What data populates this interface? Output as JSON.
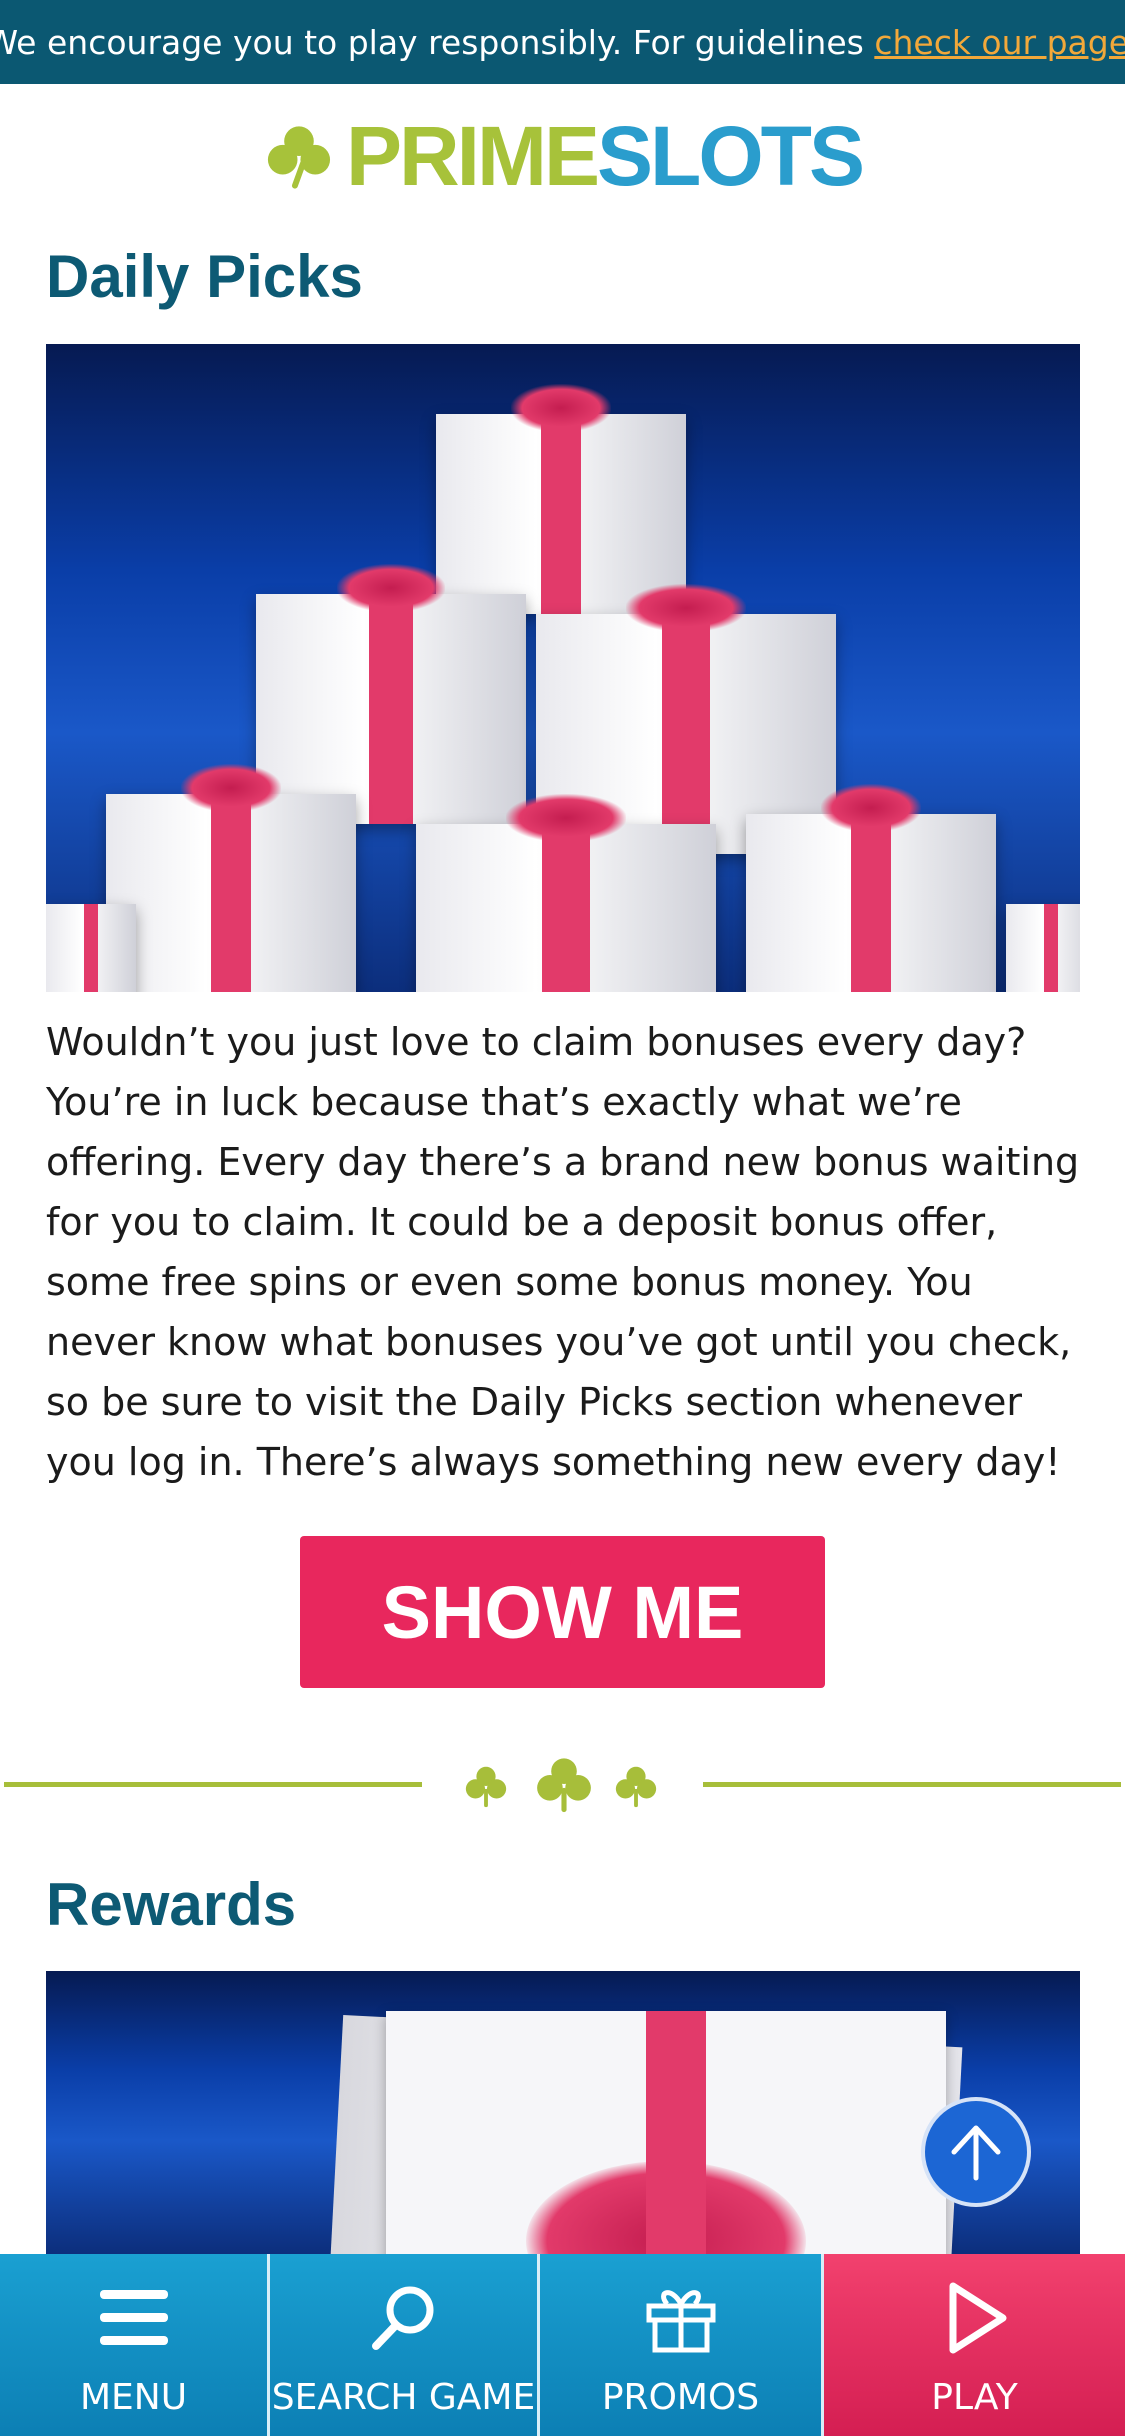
{
  "banner": {
    "text": "We encourage you to play responsibly. For guidelines ",
    "link_text": "check our page",
    "suffix": "."
  },
  "logo": {
    "part1": "PRIME",
    "part2": "SLOTS"
  },
  "sections": [
    {
      "title": "Daily Picks",
      "body": "Wouldn’t you just love to claim bonuses every day? You’re in luck because that’s exactly what we’re offering. Every day there’s a brand new bonus waiting for you to claim. It could be a deposit bonus offer, some free spins or even some bonus money. You never know what bonuses you’ve got until you check, so be sure to visit the Daily Picks section whenever you log in. There’s always something new every day!",
      "button": "SHOW ME"
    },
    {
      "title": "Rewards"
    }
  ],
  "bottom_nav": [
    {
      "label": "MENU",
      "icon": "menu-icon"
    },
    {
      "label": "SEARCH GAME",
      "icon": "search-icon"
    },
    {
      "label": "PROMOS",
      "icon": "gift-icon"
    },
    {
      "label": "PLAY",
      "icon": "play-icon"
    }
  ],
  "colors": {
    "banner_bg": "#0b5872",
    "link": "#f2a83a",
    "heading": "#0d5a74",
    "cta": "#e8275d",
    "nav_blue": "#1195c8",
    "nav_play": "#e8275d",
    "divider_green": "#a7be3a"
  }
}
